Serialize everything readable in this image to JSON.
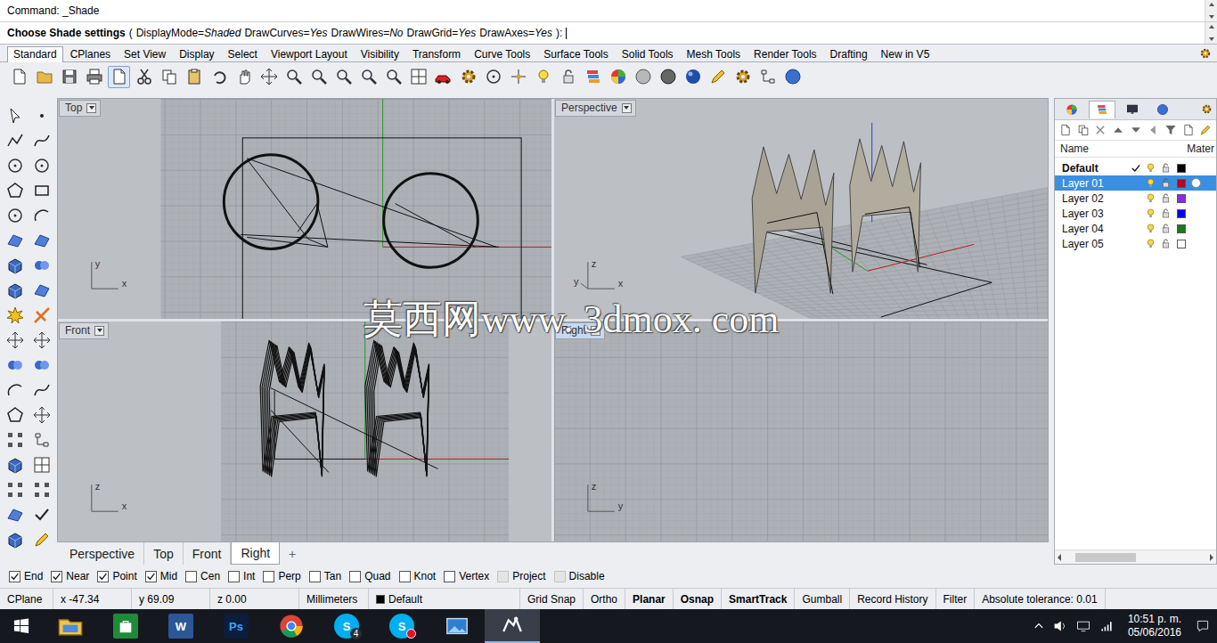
{
  "command": {
    "history": "Command: _Shade",
    "prompt": "Choose Shade settings",
    "open": "(",
    "options": [
      {
        "name": "DisplayMode=",
        "value": "Shaded"
      },
      {
        "name": "DrawCurves=",
        "value": "Yes"
      },
      {
        "name": "DrawWires=",
        "value": "No"
      },
      {
        "name": "DrawGrid=",
        "value": "Yes"
      },
      {
        "name": "DrawAxes=",
        "value": "Yes"
      }
    ],
    "close": "):"
  },
  "toolbar_tabs": [
    {
      "label": "Standard",
      "selected": true
    },
    {
      "label": "CPlanes",
      "selected": false
    },
    {
      "label": "Set View",
      "selected": false
    },
    {
      "label": "Display",
      "selected": false
    },
    {
      "label": "Select",
      "selected": false
    },
    {
      "label": "Viewport Layout",
      "selected": false
    },
    {
      "label": "Visibility",
      "selected": false
    },
    {
      "label": "Transform",
      "selected": false
    },
    {
      "label": "Curve Tools",
      "selected": false
    },
    {
      "label": "Surface Tools",
      "selected": false
    },
    {
      "label": "Solid Tools",
      "selected": false
    },
    {
      "label": "Mesh Tools",
      "selected": false
    },
    {
      "label": "Render Tools",
      "selected": false
    },
    {
      "label": "Drafting",
      "selected": false
    },
    {
      "label": "New in V5",
      "selected": false
    }
  ],
  "viewports": [
    {
      "label": "Top",
      "selected": false,
      "axes": [
        "y",
        "x"
      ]
    },
    {
      "label": "Perspective",
      "selected": false,
      "axes": [
        "z",
        "y",
        "x"
      ]
    },
    {
      "label": "Front",
      "selected": false,
      "axes": [
        "z",
        "x"
      ]
    },
    {
      "label": "Right",
      "selected": true,
      "axes": [
        "z",
        "y"
      ]
    }
  ],
  "viewport_tabs": [
    {
      "label": "Perspective",
      "selected": false
    },
    {
      "label": "Top",
      "selected": false
    },
    {
      "label": "Front",
      "selected": false
    },
    {
      "label": "Right",
      "selected": true
    }
  ],
  "add_tab": "+",
  "watermark": "莫西网www. 3dmox. com",
  "layers": {
    "columns": [
      "Name",
      "Mater"
    ],
    "rows": [
      {
        "name": "Default",
        "current": true,
        "selected": false,
        "color": "#000000",
        "material": false
      },
      {
        "name": "Layer 01",
        "current": false,
        "selected": true,
        "color": "#c0001a",
        "material": true
      },
      {
        "name": "Layer 02",
        "current": false,
        "selected": false,
        "color": "#8a2be2",
        "material": false
      },
      {
        "name": "Layer 03",
        "current": false,
        "selected": false,
        "color": "#0000ff",
        "material": false
      },
      {
        "name": "Layer 04",
        "current": false,
        "selected": false,
        "color": "#1a7a1a",
        "material": false
      },
      {
        "name": "Layer 05",
        "current": false,
        "selected": false,
        "color": "#ffffff",
        "material": false
      }
    ]
  },
  "osnaps": [
    {
      "label": "End",
      "checked": true,
      "kind": "snap"
    },
    {
      "label": "Near",
      "checked": true,
      "kind": "snap"
    },
    {
      "label": "Point",
      "checked": true,
      "kind": "snap"
    },
    {
      "label": "Mid",
      "checked": true,
      "kind": "snap"
    },
    {
      "label": "Cen",
      "checked": false,
      "kind": "snap"
    },
    {
      "label": "Int",
      "checked": false,
      "kind": "snap"
    },
    {
      "label": "Perp",
      "checked": false,
      "kind": "snap"
    },
    {
      "label": "Tan",
      "checked": false,
      "kind": "snap"
    },
    {
      "label": "Quad",
      "checked": false,
      "kind": "snap"
    },
    {
      "label": "Knot",
      "checked": false,
      "kind": "snap"
    },
    {
      "label": "Vertex",
      "checked": false,
      "kind": "snap"
    },
    {
      "label": "Project",
      "checked": false,
      "kind": "mode"
    },
    {
      "label": "Disable",
      "checked": false,
      "kind": "mode"
    }
  ],
  "status_bar": {
    "cplane": "CPlane",
    "coords": [
      "x -47.34",
      "y 69.09",
      "z 0.00"
    ],
    "units": "Millimeters",
    "layer": {
      "name": "Default",
      "color": "#000000"
    },
    "toggles": [
      {
        "label": "Grid Snap",
        "on": false
      },
      {
        "label": "Ortho",
        "on": false
      },
      {
        "label": "Planar",
        "on": true
      },
      {
        "label": "Osnap",
        "on": true
      },
      {
        "label": "SmartTrack",
        "on": true
      },
      {
        "label": "Gumball",
        "on": false
      },
      {
        "label": "Record History",
        "on": false
      },
      {
        "label": "Filter",
        "on": false
      }
    ],
    "tolerance": "Absolute tolerance: 0.01"
  },
  "taskbar": {
    "apps": [
      {
        "kind": "explorer",
        "glyph": "",
        "badge": "",
        "alert": false,
        "active": false
      },
      {
        "kind": "store",
        "glyph": "",
        "badge": "",
        "alert": false,
        "active": false
      },
      {
        "kind": "word",
        "glyph": "W",
        "badge": "",
        "alert": false,
        "active": false
      },
      {
        "kind": "photoshop",
        "glyph": "Ps",
        "badge": "",
        "alert": false,
        "active": false
      },
      {
        "kind": "chrome",
        "glyph": "",
        "badge": "",
        "alert": false,
        "active": false
      },
      {
        "kind": "skype",
        "glyph": "S",
        "badge": "4",
        "alert": false,
        "active": false
      },
      {
        "kind": "skype",
        "glyph": "S",
        "badge": "",
        "alert": true,
        "active": false
      },
      {
        "kind": "photos",
        "glyph": "",
        "badge": "",
        "alert": false,
        "active": false
      },
      {
        "kind": "rhino",
        "glyph": "",
        "badge": "",
        "alert": false,
        "active": true
      }
    ],
    "time": "10:51 p. m.",
    "date": "05/06/2016"
  }
}
